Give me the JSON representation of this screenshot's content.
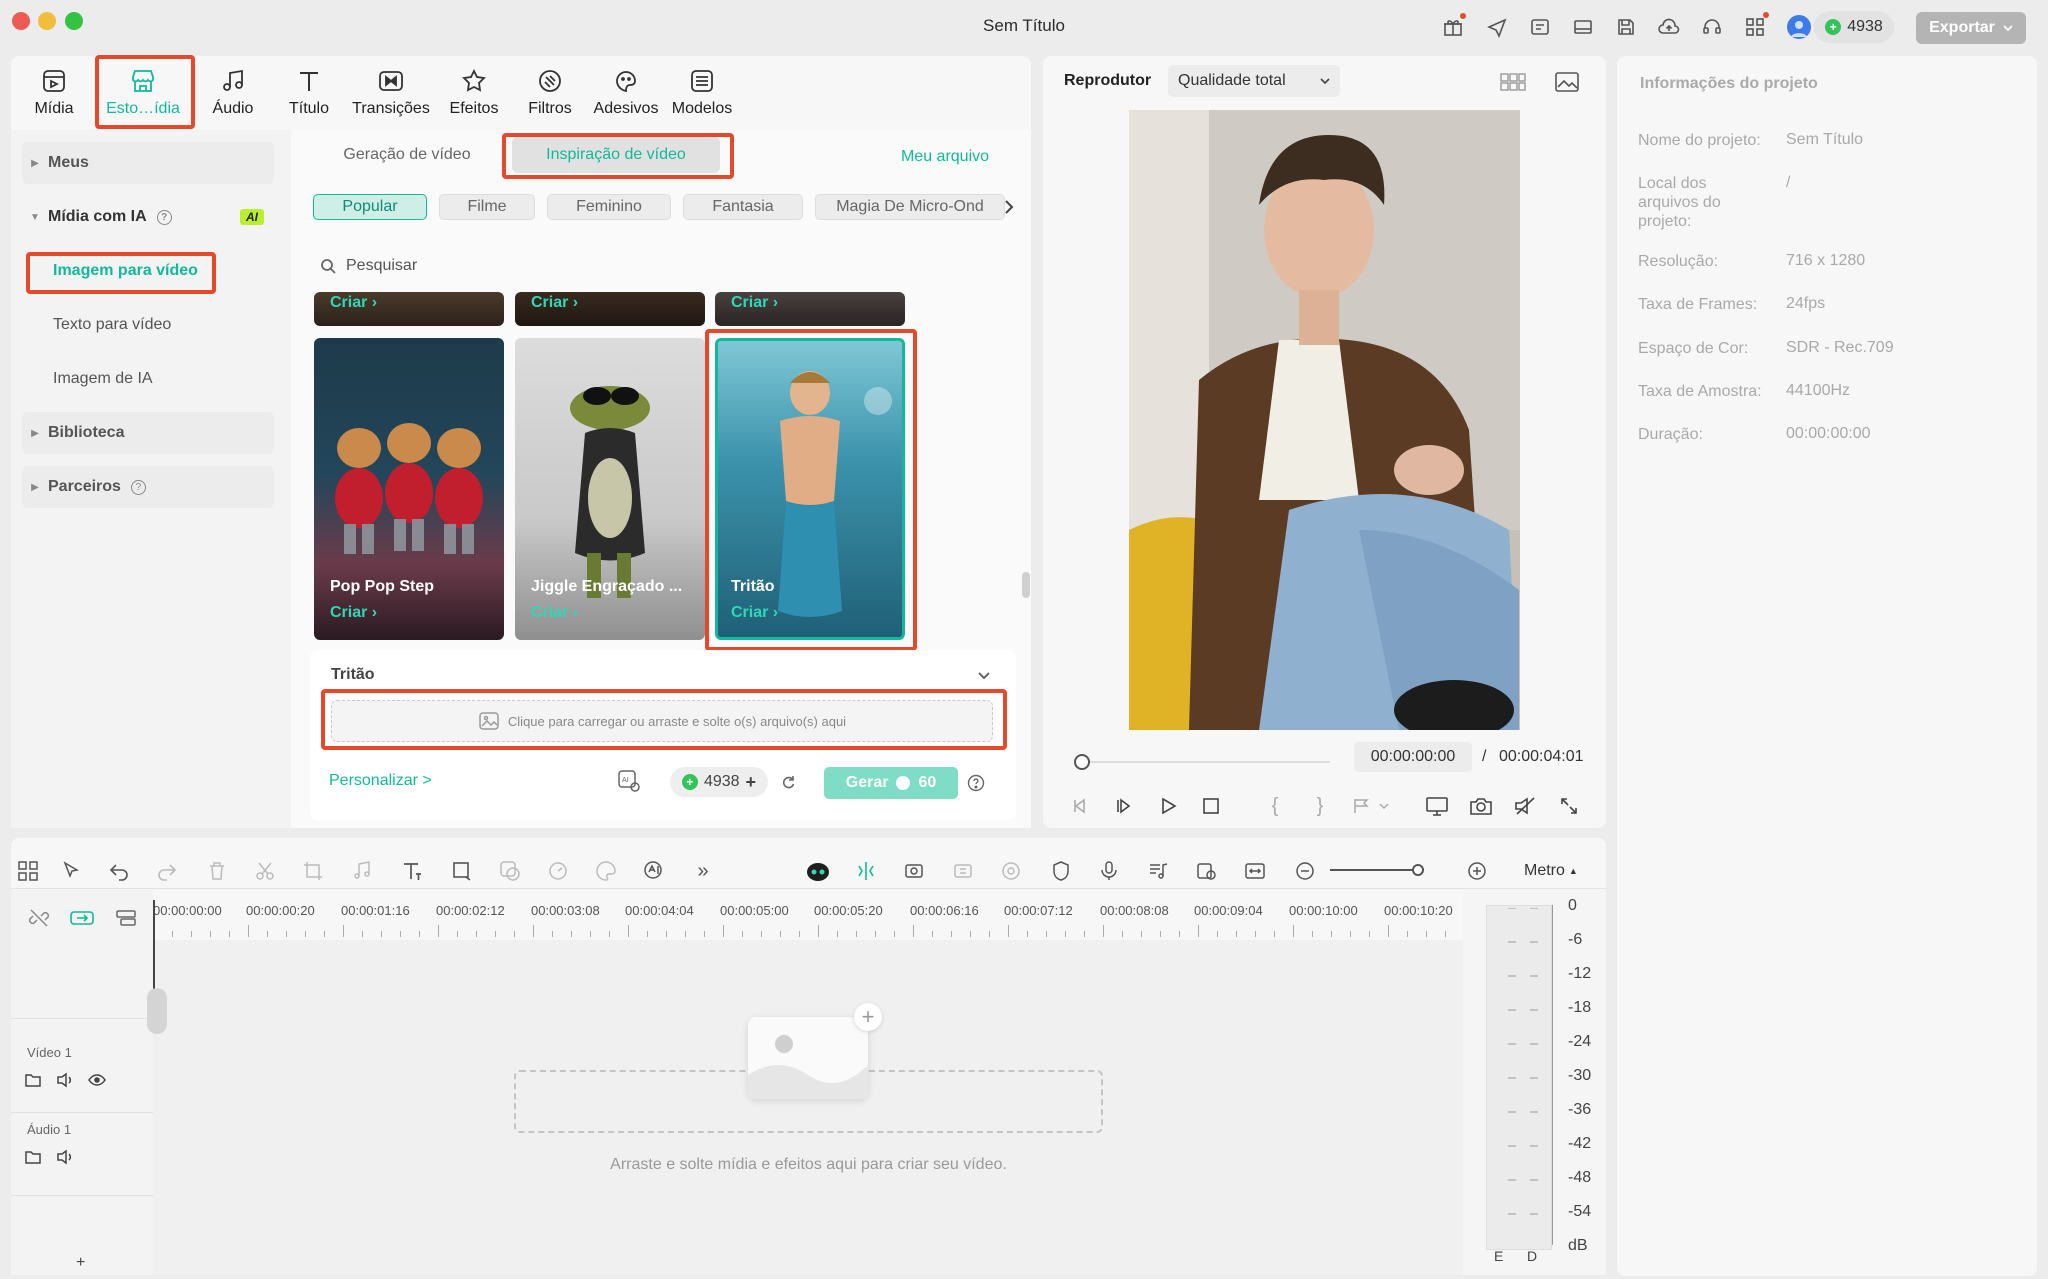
{
  "window": {
    "title": "Sem Título"
  },
  "credits": "4938",
  "export_label": "Exportar",
  "toolbar": {
    "tabs": [
      {
        "label": "Mídia",
        "icon": "media-icon"
      },
      {
        "label": "Esto…ídia",
        "icon": "store-icon",
        "active": true
      },
      {
        "label": "Áudio",
        "icon": "music-note-icon"
      },
      {
        "label": "Título",
        "icon": "title-text-icon"
      },
      {
        "label": "Transições",
        "icon": "transition-icon"
      },
      {
        "label": "Efeitos",
        "icon": "effects-icon"
      },
      {
        "label": "Filtros",
        "icon": "filter-icon"
      },
      {
        "label": "Adesivos",
        "icon": "sticker-icon"
      },
      {
        "label": "Modelos",
        "icon": "template-icon"
      }
    ]
  },
  "sidebar": {
    "meus": "Meus",
    "midia_ia": "Mídia com IA",
    "ai_badge": "AI",
    "imagem_para_video": "Imagem para vídeo",
    "texto_para_video": "Texto para vídeo",
    "imagem_ia": "Imagem de IA",
    "biblioteca": "Biblioteca",
    "parceiros": "Parceiros"
  },
  "content": {
    "subtabs": {
      "geracao": "Geração de vídeo",
      "inspiracao": "Inspiração de vídeo",
      "meu_arquivo": "Meu arquivo"
    },
    "chips": [
      "Popular",
      "Filme",
      "Feminino",
      "Fantasia",
      "Magia De Micro-Ond"
    ],
    "search_placeholder": "Pesquisar",
    "create_label": "Criar ›",
    "cards": [
      {
        "title": "Pop Pop Step"
      },
      {
        "title": "Jiggle Engraçado ..."
      },
      {
        "title": "Tritão"
      }
    ],
    "section_title": "Tritão",
    "upload_text": "Clique para carregar ou arraste e solte o(s) arquivo(s) aqui",
    "personalizar": "Personalizar >",
    "credit_count": "4938",
    "gerar_label": "Gerar",
    "gerar_cost": "60"
  },
  "player": {
    "label": "Reprodutor",
    "quality": "Qualidade total",
    "current_time": "00:00:00:00",
    "separator": "/",
    "total_time": "00:00:04:01"
  },
  "project_info": {
    "title": "Informações do projeto",
    "rows": [
      {
        "label": "Nome do projeto:",
        "value": "Sem Título"
      },
      {
        "label": "Local dos arquivos do projeto:",
        "value": "/"
      },
      {
        "label": "Resolução:",
        "value": "716 x 1280"
      },
      {
        "label": "Taxa de Frames:",
        "value": "24fps"
      },
      {
        "label": "Espaço de Cor:",
        "value": "SDR - Rec.709"
      },
      {
        "label": "Taxa de Amostra:",
        "value": "44100Hz"
      },
      {
        "label": "Duração:",
        "value": "00:00:00:00"
      }
    ]
  },
  "timeline": {
    "meter_label": "Metro",
    "ruler": [
      "00:00:00:00",
      "00:00:00:20",
      "00:00:01:16",
      "00:00:02:12",
      "00:00:03:08",
      "00:00:04:04",
      "00:00:05:00",
      "00:00:05:20",
      "00:00:06:16",
      "00:00:07:12",
      "00:00:08:08",
      "00:00:09:04",
      "00:00:10:00",
      "00:00:10:20"
    ],
    "video_track": "Vídeo 1",
    "audio_track": "Áudio 1",
    "drop_hint": "Arraste e solte mídia e efeitos aqui para criar seu vídeo.",
    "meter_scale": [
      "0",
      "-6",
      "-12",
      "-18",
      "-24",
      "-30",
      "-36",
      "-42",
      "-48",
      "-54",
      "dB"
    ],
    "meter_channels": [
      "E",
      "D"
    ],
    "add_track": "+"
  },
  "colors": {
    "accent": "#12b89a",
    "highlight_box": "#e5492b"
  }
}
